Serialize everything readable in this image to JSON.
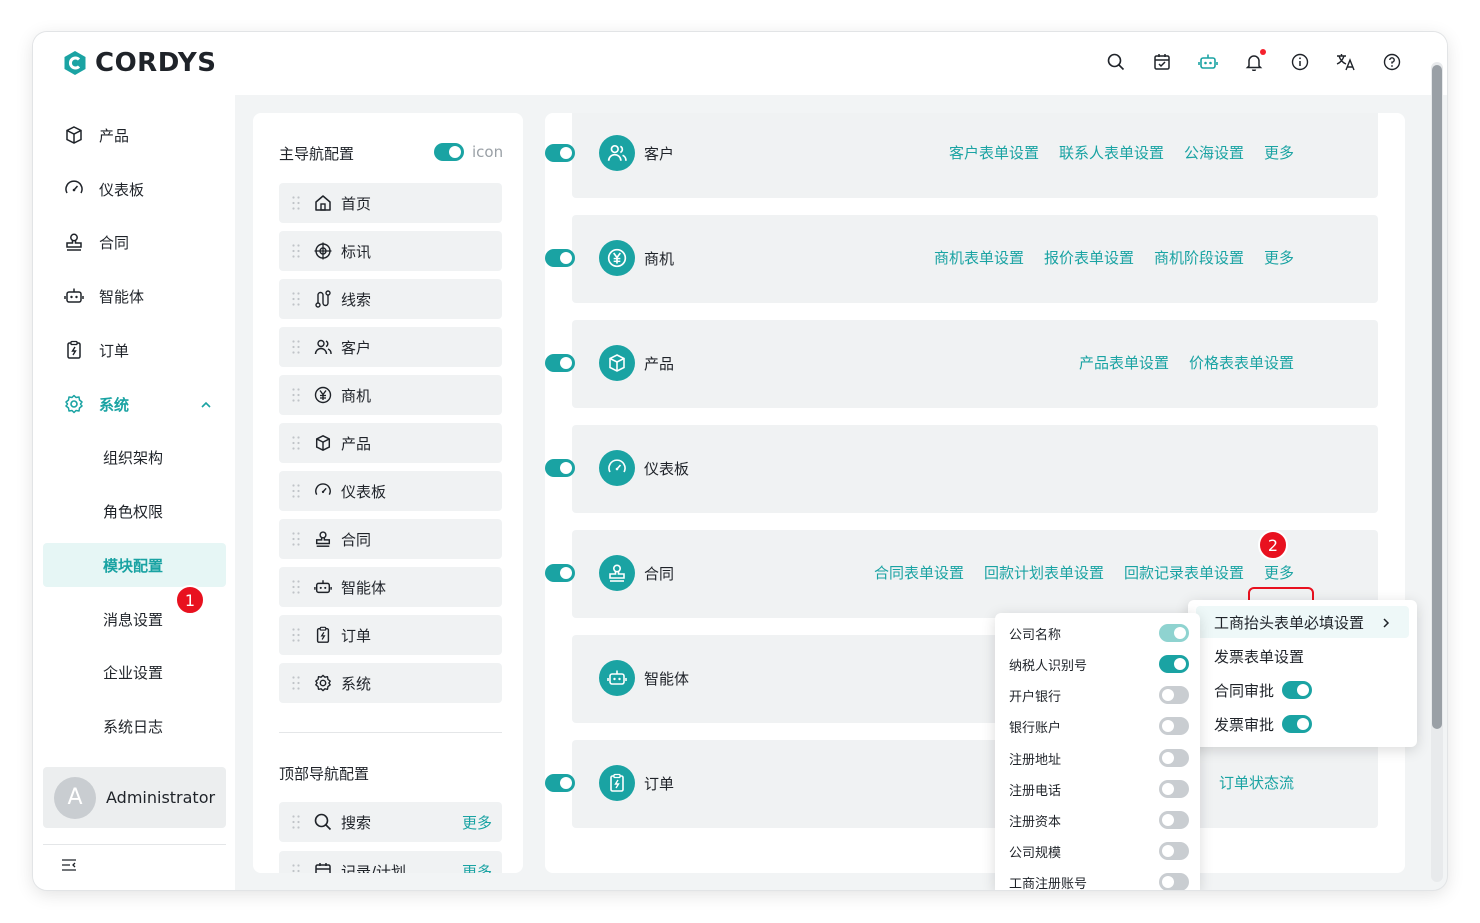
{
  "app": {
    "brand": "CORDYS",
    "brand_color": "#1aa3a3"
  },
  "topbar": {
    "icons": [
      "search-icon",
      "calendar-check-icon",
      "robot-icon",
      "bell-icon",
      "info-icon",
      "translate-icon",
      "help-icon"
    ],
    "notification_dot_color": "#f5222d"
  },
  "sidebar": {
    "items": [
      {
        "label": "产品",
        "icon": "box-icon"
      },
      {
        "label": "仪表板",
        "icon": "gauge-icon"
      },
      {
        "label": "合同",
        "icon": "stamp-icon"
      },
      {
        "label": "智能体",
        "icon": "robot-icon"
      },
      {
        "label": "订单",
        "icon": "order-icon"
      },
      {
        "label": "系统",
        "icon": "gear-icon"
      }
    ],
    "sub_items": [
      "组织架构",
      "角色权限",
      "模块配置",
      "消息设置",
      "企业设置",
      "系统日志"
    ],
    "selected": "模块配置",
    "user": {
      "avatar_letter": "A",
      "name": "Administrator"
    }
  },
  "annotations": {
    "badge1": "1",
    "badge2": "2",
    "color": "#e8111f"
  },
  "main_nav": {
    "title": "主导航配置",
    "icon_label": "icon",
    "icon_toggle": true,
    "items": [
      {
        "label": "首页",
        "icon": "home-icon"
      },
      {
        "label": "标讯",
        "icon": "target-icon"
      },
      {
        "label": "线索",
        "icon": "route-icon"
      },
      {
        "label": "客户",
        "icon": "users-icon"
      },
      {
        "label": "商机",
        "icon": "yen-icon"
      },
      {
        "label": "产品",
        "icon": "box-icon"
      },
      {
        "label": "仪表板",
        "icon": "gauge-icon"
      },
      {
        "label": "合同",
        "icon": "stamp-icon"
      },
      {
        "label": "智能体",
        "icon": "robot-icon"
      },
      {
        "label": "订单",
        "icon": "order-icon"
      },
      {
        "label": "系统",
        "icon": "gear-icon"
      }
    ]
  },
  "top_nav": {
    "title": "顶部导航配置",
    "items": [
      {
        "label": "搜索",
        "more": "更多",
        "icon": "search-icon"
      },
      {
        "label": "记录/计划",
        "more": "更多",
        "icon": "calendar-check-icon"
      }
    ]
  },
  "modules": [
    {
      "name": "客户",
      "icon": "users-icon",
      "links": [
        "客户表单设置",
        "联系人表单设置",
        "公海设置",
        "更多"
      ],
      "enabled": true
    },
    {
      "name": "商机",
      "icon": "yen-icon",
      "links": [
        "商机表单设置",
        "报价表单设置",
        "商机阶段设置",
        "更多"
      ],
      "enabled": true
    },
    {
      "name": "产品",
      "icon": "box-icon",
      "links": [
        "产品表单设置",
        "价格表表单设置"
      ],
      "enabled": true
    },
    {
      "name": "仪表板",
      "icon": "gauge-icon",
      "links": [],
      "enabled": true
    },
    {
      "name": "合同",
      "icon": "stamp-icon",
      "links": [
        "合同表单设置",
        "回款计划表单设置",
        "回款记录表单设置",
        "更多"
      ],
      "enabled": true
    },
    {
      "name": "智能体",
      "icon": "robot-icon",
      "links": [],
      "enabled": true
    },
    {
      "name": "订单",
      "icon": "order-icon",
      "links": [
        "订单状态流"
      ],
      "enabled": true
    }
  ],
  "more_menu": {
    "items": [
      {
        "label": "工商抬头表单必填设置",
        "has_submenu": true
      },
      {
        "label": "发票表单设置"
      },
      {
        "label": "合同审批",
        "toggle": true
      },
      {
        "label": "发票审批",
        "toggle": true
      }
    ]
  },
  "required_fields": [
    {
      "label": "公司名称",
      "state": "locked-on"
    },
    {
      "label": "纳税人识别号",
      "state": "on"
    },
    {
      "label": "开户银行",
      "state": "off"
    },
    {
      "label": "银行账户",
      "state": "off"
    },
    {
      "label": "注册地址",
      "state": "off"
    },
    {
      "label": "注册电话",
      "state": "off"
    },
    {
      "label": "注册资本",
      "state": "off"
    },
    {
      "label": "公司规模",
      "state": "off"
    },
    {
      "label": "工商注册账号",
      "state": "off"
    }
  ]
}
